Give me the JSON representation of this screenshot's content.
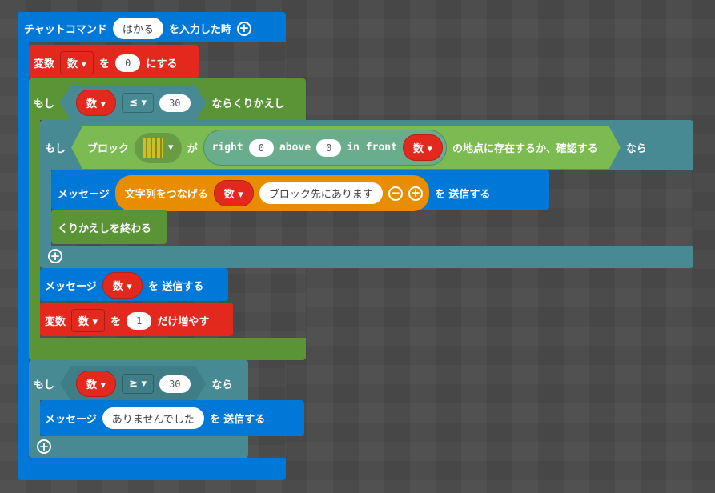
{
  "colors": {
    "event": "#0078d7",
    "variables": "#e3291e",
    "loops": "#5b9337",
    "logic": "#478a94",
    "text": "#e88d00",
    "blocks": "#7cba52"
  },
  "event": {
    "label": "チャットコマンド",
    "command": "はかる",
    "suffix": "を入力した時"
  },
  "set_var": {
    "label": "変数",
    "var": "数",
    "to": "を",
    "value": "0",
    "suffix": "にする"
  },
  "while": {
    "if": "もし",
    "var": "数",
    "op": "≤",
    "value": "30",
    "suffix": "ならくりかえし"
  },
  "if1": {
    "if": "もし",
    "block": "ブロック",
    "ga": "が",
    "right": "right",
    "right_val": "0",
    "above": "above",
    "above_val": "0",
    "front": "in front",
    "front_var": "数",
    "check": "の地点に存在するか、確認する",
    "then": "なら"
  },
  "msg1": {
    "label": "メッセージ",
    "join": "文字列をつなげる",
    "var": "数",
    "text": "ブロック先にあります",
    "send": "を 送信する"
  },
  "break": {
    "label": "くりかえしを終わる"
  },
  "msg2": {
    "label": "メッセージ",
    "var": "数",
    "send": "を 送信する"
  },
  "change": {
    "label": "変数",
    "var": "数",
    "by": "を",
    "value": "1",
    "suffix": "だけ増やす"
  },
  "if2": {
    "if": "もし",
    "var": "数",
    "op": "≥",
    "value": "30",
    "then": "なら"
  },
  "msg3": {
    "label": "メッセージ",
    "text": "ありませんでした",
    "send": "を 送信する"
  }
}
